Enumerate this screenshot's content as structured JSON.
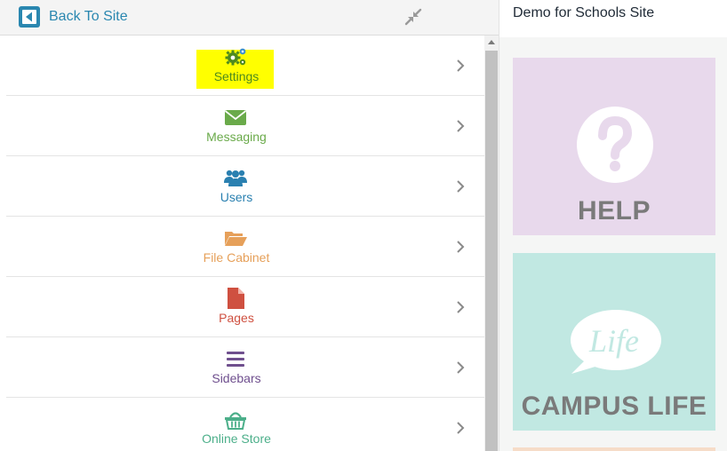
{
  "header": {
    "back_label": "Back To Site",
    "back_icon": "back-arrow-icon",
    "collapse_icon": "collapse-arrows-icon"
  },
  "menu": {
    "items": [
      {
        "label": "Settings",
        "icon": "gears-icon",
        "color": "#4e8a1e",
        "highlighted": true
      },
      {
        "label": "Messaging",
        "icon": "envelope-icon",
        "color": "#6aaa4a"
      },
      {
        "label": "Users",
        "icon": "users-icon",
        "color": "#2a80b0"
      },
      {
        "label": "File Cabinet",
        "icon": "folder-open-icon",
        "color": "#e6a05a"
      },
      {
        "label": "Pages",
        "icon": "file-icon",
        "color": "#cf5040"
      },
      {
        "label": "Sidebars",
        "icon": "bars-icon",
        "color": "#6f4f8e"
      },
      {
        "label": "Online Store",
        "icon": "basket-icon",
        "color": "#4caf8a"
      }
    ]
  },
  "site": {
    "title": "Demo for Schools Site",
    "tiles": [
      {
        "caption": "HELP",
        "bg": "#e8d9ec",
        "icon": "question-circle-icon"
      },
      {
        "caption": "CAMPUS LIFE",
        "bg": "#c1e8e2",
        "icon": "life-speech-bubble-icon",
        "icon_text": "Life"
      }
    ]
  },
  "colors": {
    "accent": "#2a87b0",
    "highlight": "#ffff00"
  }
}
